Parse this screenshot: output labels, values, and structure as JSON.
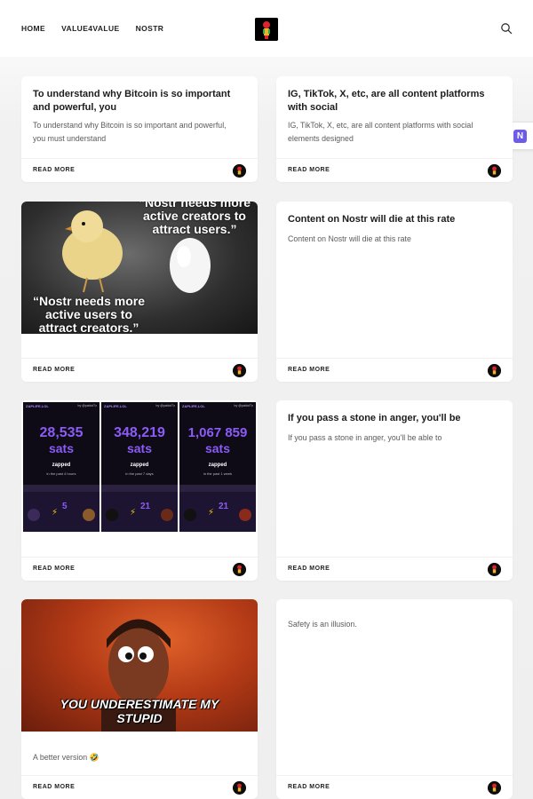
{
  "nav": {
    "items": [
      "HOME",
      "VALUE4VALUE",
      "NOSTR"
    ]
  },
  "side_badge": {
    "letter": "N"
  },
  "cards": [
    {
      "title": "To understand why Bitcoin is so important and powerful, you",
      "excerpt": "To understand why Bitcoin is so important and powerful, you must understand",
      "more": "READ MORE"
    },
    {
      "title": "IG, TikTok, X, etc, are all content platforms with social",
      "excerpt": "IG, TikTok, X, etc, are all content platforms with social elements designed",
      "more": "READ MORE"
    },
    {
      "image_text_top": "“Nostr needs more active creators to attract users.”",
      "image_text_bottom": "“Nostr needs more active users to attract creators.”",
      "more": "READ MORE"
    },
    {
      "title": "Content on Nostr will die at this rate",
      "excerpt": "Content on Nostr will die at this rate",
      "more": "READ MORE"
    },
    {
      "panels": [
        {
          "brand": "ZAPLIFE.LOL",
          "by": "by @pablof7z",
          "amount": "28,535",
          "unit": "sats",
          "label": "zapped",
          "sub": "in the past 4 hours",
          "count": "5"
        },
        {
          "brand": "ZAPLIFE.LOL",
          "by": "by @pablof7z",
          "amount": "348,219",
          "unit": "sats",
          "label": "zapped",
          "sub": "in the past 7 days",
          "count": "21"
        },
        {
          "brand": "ZAPLIFE.LOL",
          "by": "by @pablof7z",
          "amount": "1,067 859",
          "unit": "sats",
          "label": "zapped",
          "sub": "in the past 1 week",
          "count": "21"
        }
      ],
      "more": "READ MORE"
    },
    {
      "title": "If you pass a stone in anger, you'll be",
      "excerpt": "If you pass a stone in anger, you'll be able to",
      "more": "READ MORE"
    },
    {
      "image_text": "YOU UNDERESTIMATE MY STUPID",
      "excerpt": "A better version 🤣",
      "more": "READ MORE"
    },
    {
      "excerpt": "Safety is an illusion.",
      "more": "READ MORE"
    }
  ],
  "colors": {
    "zap_purple": "#8b5cf6",
    "meme_red": "#c0391b",
    "badge_purple": "#6c5ce7"
  }
}
